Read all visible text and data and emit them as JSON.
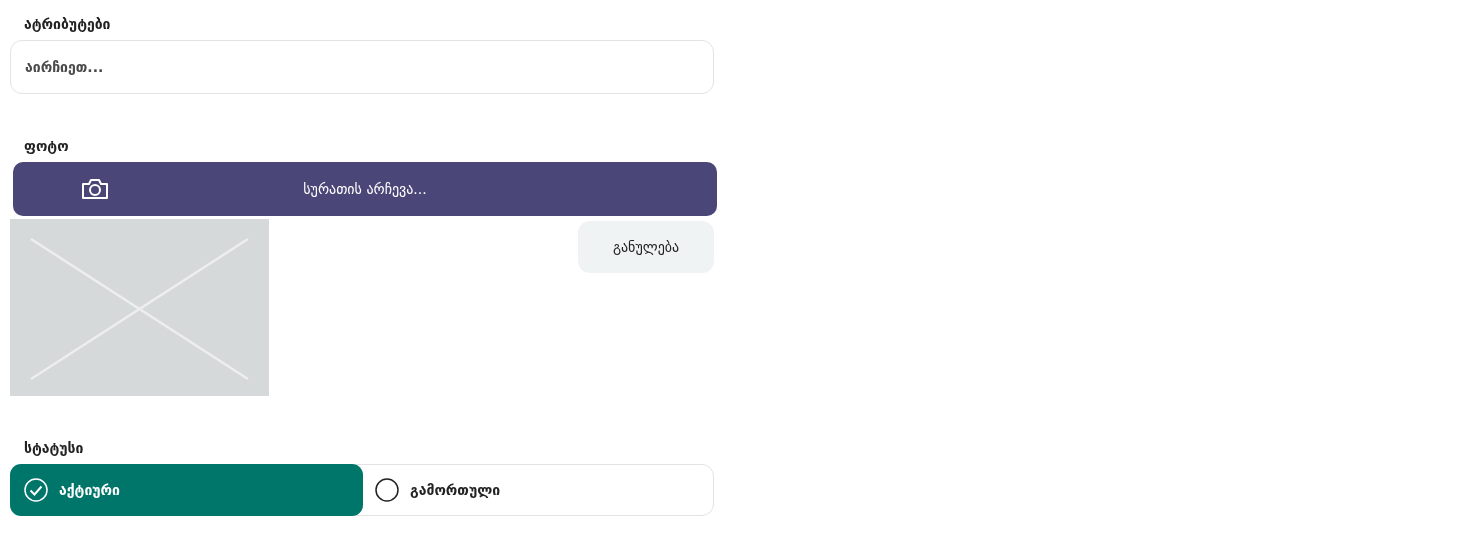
{
  "attributes": {
    "label": "ატრიბუტები",
    "placeholder": "აირჩიეთ..."
  },
  "photo": {
    "label": "ფოტო",
    "choose_button": "სურათის არჩევა...",
    "reset_button": "განულება"
  },
  "status": {
    "label": "სტატუსი",
    "options": [
      {
        "label": "აქტიური",
        "selected": true
      },
      {
        "label": "გამორთული",
        "selected": false
      }
    ]
  }
}
